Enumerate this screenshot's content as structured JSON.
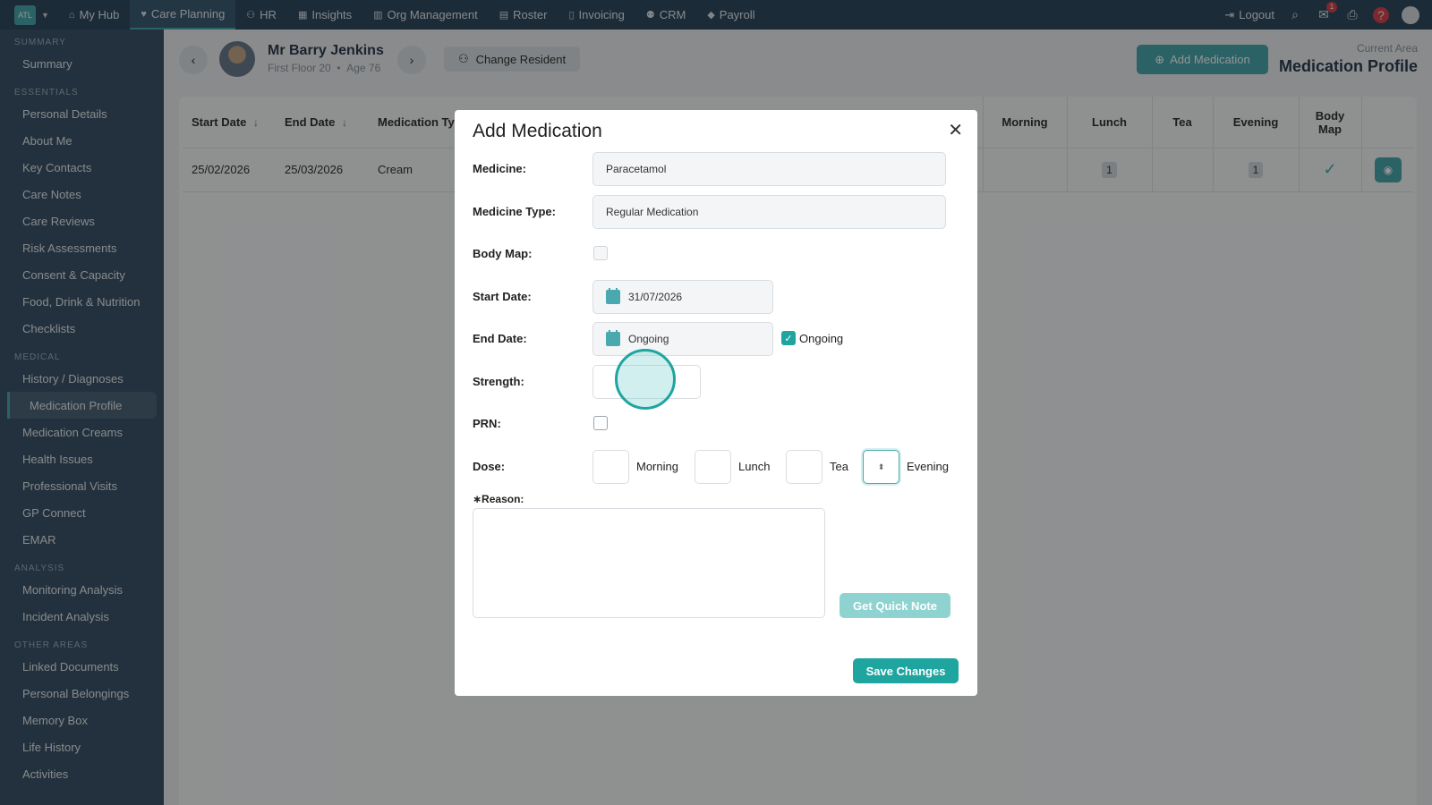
{
  "topnav": {
    "logo": "ATL",
    "items": [
      {
        "label": "My Hub",
        "icon": "home-icon"
      },
      {
        "label": "Care Planning",
        "icon": "heart-icon"
      },
      {
        "label": "HR",
        "icon": "people-icon"
      },
      {
        "label": "Insights",
        "icon": "chart-icon"
      },
      {
        "label": "Org Management",
        "icon": "building-icon"
      },
      {
        "label": "Roster",
        "icon": "calendar-icon"
      },
      {
        "label": "Invoicing",
        "icon": "document-icon"
      },
      {
        "label": "CRM",
        "icon": "contacts-icon"
      },
      {
        "label": "Payroll",
        "icon": "tag-icon"
      }
    ],
    "logout": "Logout",
    "mail_badge": "1",
    "help": "?"
  },
  "sidebar": {
    "sections": [
      {
        "title": "SUMMARY",
        "items": [
          "Summary"
        ]
      },
      {
        "title": "ESSENTIALS",
        "items": [
          "Personal Details",
          "About Me",
          "Key Contacts",
          "Care Notes",
          "Care Reviews",
          "Risk Assessments",
          "Consent & Capacity",
          "Food, Drink & Nutrition",
          "Checklists"
        ]
      },
      {
        "title": "MEDICAL",
        "items": [
          "History / Diagnoses",
          "Medication Profile",
          "Medication Creams",
          "Health Issues",
          "Professional Visits",
          "GP Connect",
          "EMAR"
        ]
      },
      {
        "title": "ANALYSIS",
        "items": [
          "Monitoring Analysis",
          "Incident Analysis"
        ]
      },
      {
        "title": "OTHER AREAS",
        "items": [
          "Linked Documents",
          "Personal Belongings",
          "Memory Box",
          "Life History",
          "Activities"
        ]
      }
    ],
    "active": "Medication Profile"
  },
  "header": {
    "resident_name": "Mr Barry Jenkins",
    "resident_location": "First Floor 20",
    "resident_age": "Age 76",
    "change_resident": "Change Resident",
    "add_medication": "Add Medication",
    "current_area_label": "Current Area",
    "current_area": "Medication Profile"
  },
  "table": {
    "headers": {
      "start_date": "Start Date",
      "end_date": "End Date",
      "medication_type": "Medication Ty",
      "morning": "Morning",
      "lunch": "Lunch",
      "tea": "Tea",
      "evening": "Evening",
      "body_map_1": "Body",
      "body_map_2": "Map"
    },
    "row": {
      "start_date": "25/02/2026",
      "end_date": "25/03/2026",
      "medication_type": "Cream",
      "morning": "",
      "lunch": "1",
      "tea": "",
      "evening": "1",
      "body_map": "✓"
    }
  },
  "modal": {
    "title": "Add Medication",
    "medicine_label": "Medicine:",
    "medicine_value": "Paracetamol",
    "medicine_type_label": "Medicine Type:",
    "medicine_type_value": "Regular Medication",
    "body_map_label": "Body Map:",
    "start_date_label": "Start Date:",
    "start_date_value": "31/07/2026",
    "end_date_label": "End Date:",
    "end_date_value": "Ongoing",
    "ongoing_label": "Ongoing",
    "strength_label": "Strength:",
    "prn_label": "PRN:",
    "dose_label": "Dose:",
    "dose_morning": "Morning",
    "dose_lunch": "Lunch",
    "dose_tea": "Tea",
    "dose_evening": "Evening",
    "reason_label": "∗Reason:",
    "quick_note": "Get Quick Note",
    "save": "Save Changes"
  }
}
